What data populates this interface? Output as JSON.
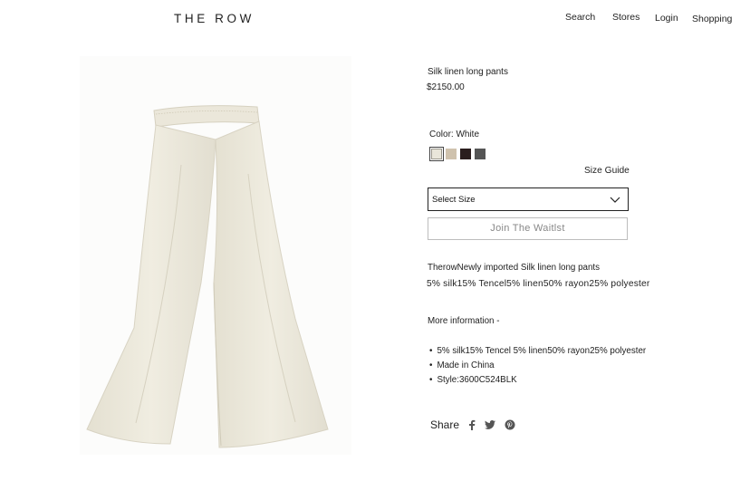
{
  "header": {
    "logo": "THE ROW",
    "nav": {
      "search": "Search",
      "stores": "Stores",
      "login": "Login",
      "shopping": "Shopping"
    }
  },
  "product": {
    "name": "Silk linen long pants",
    "price": "$2150.00",
    "color_label": "Color: White",
    "swatches": [
      {
        "name": "white",
        "color": "#e9e6da",
        "selected": true
      },
      {
        "name": "beige",
        "color": "#cfc2ad",
        "selected": false
      },
      {
        "name": "black",
        "color": "#2a1d1d",
        "selected": false
      },
      {
        "name": "gray",
        "color": "#555555",
        "selected": false
      }
    ],
    "size_guide": "Size Guide",
    "select_size": "Select Size",
    "waitlist_button": "Join  The Waitlst",
    "description_title": "TherowNewly imported Silk linen long pants",
    "composition": "5% silk15% Tencel5% linen50% rayon25% polyester",
    "more_info_label": "More information -",
    "more_info_items": [
      "5% silk15% Tencel 5% linen50% rayon25% polyester",
      "Made in China",
      "Style:3600C524BLK"
    ],
    "share_label": "Share",
    "share_icons": [
      "facebook-icon",
      "twitter-icon",
      "pinterest-icon"
    ]
  }
}
